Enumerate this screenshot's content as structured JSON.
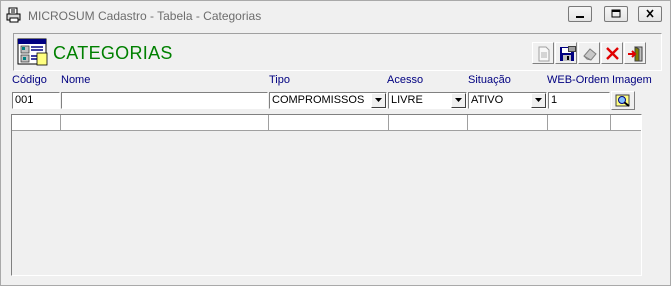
{
  "window": {
    "title": "MICROSUM Cadastro - Tabela - Categorias",
    "controls": [
      "minimize",
      "maximize",
      "close"
    ]
  },
  "header": {
    "title": "CATEGORIAS",
    "title_color": "#008000",
    "toolbar_icons": [
      "new-document-icon",
      "save-icon",
      "eraser-icon",
      "delete-icon",
      "exit-icon"
    ]
  },
  "form": {
    "labels": {
      "codigo": "Código",
      "nome": "Nome",
      "tipo": "Tipo",
      "acesso": "Acesso",
      "situacao": "Situação",
      "web_ordem": "WEB-Ordem",
      "imagem": "Imagem"
    },
    "values": {
      "codigo": "001",
      "nome": "",
      "tipo": "COMPROMISSOS",
      "acesso": "LIVRE",
      "situacao": "ATIVO",
      "web_ordem": "1"
    },
    "label_color": "#000080"
  },
  "grid": {
    "columns": [
      "",
      "",
      "",
      "",
      "",
      "",
      ""
    ],
    "rows": []
  }
}
